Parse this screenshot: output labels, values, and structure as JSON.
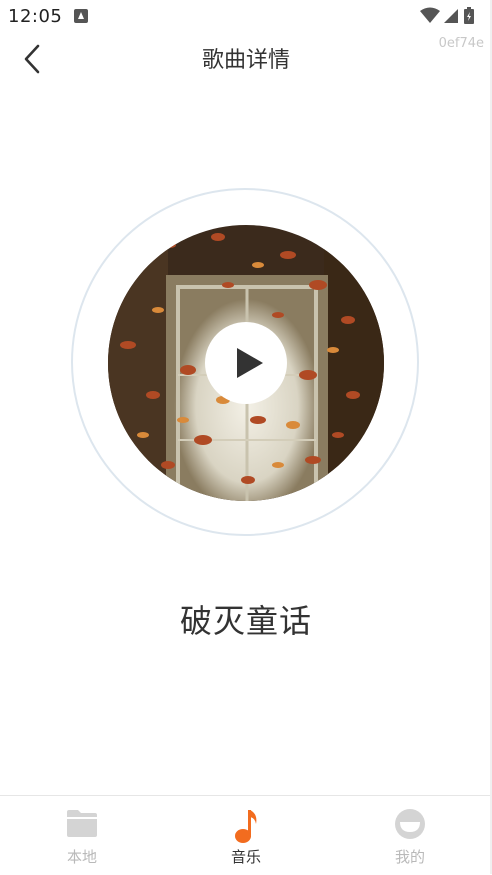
{
  "status_bar": {
    "time": "12:05",
    "notification_icon": "text-a-icon",
    "wifi_icon": "wifi-icon",
    "signal_icon": "cell-signal-icon",
    "battery_icon": "battery-charging-icon"
  },
  "build_tag": "0ef74e",
  "header": {
    "title": "歌曲详情",
    "back_icon": "chevron-left-icon"
  },
  "player": {
    "album_art": "butterflies-album-art",
    "play_icon": "play-icon",
    "song_title": "破灭童话",
    "ring_color": "#dde6ee"
  },
  "bottom_nav": {
    "items": [
      {
        "label": "本地",
        "icon": "folder-icon",
        "active": false
      },
      {
        "label": "音乐",
        "icon": "music-note-icon",
        "active": true
      },
      {
        "label": "我的",
        "icon": "profile-icon",
        "active": false
      }
    ],
    "active_color": "#f26c1f",
    "inactive_color": "#b9b9b9"
  }
}
